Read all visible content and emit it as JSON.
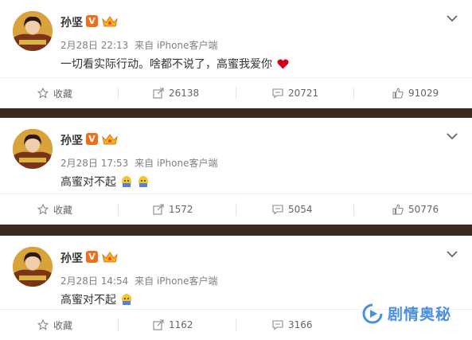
{
  "posts": [
    {
      "user": "孙坚",
      "verified_label": "V",
      "date": "2月28日 22:13",
      "source": "来自 iPhone客户端",
      "text": "一切看实际行动。啥都不说了，高蜜我爱你",
      "actions": {
        "favorite_label": "收藏",
        "repost": "26138",
        "comments": "20721",
        "likes": "91029"
      }
    },
    {
      "user": "孙坚",
      "verified_label": "V",
      "date": "2月28日 17:53",
      "source": "来自 iPhone客户端",
      "text": "高蜜对不起",
      "actions": {
        "favorite_label": "收藏",
        "repost": "1572",
        "comments": "5054",
        "likes": "50776"
      }
    },
    {
      "user": "孙坚",
      "verified_label": "V",
      "date": "2月28日 14:54",
      "source": "来自 iPhone客户端",
      "text": "高蜜对不起",
      "actions": {
        "favorite_label": "收藏",
        "repost": "1162",
        "comments": "3166",
        "likes": ""
      }
    }
  ],
  "watermark": {
    "text": "剧情奥秘"
  },
  "colors": {
    "badge": "#f06d1a",
    "heart": "#d0021b",
    "separator": "#3a2a1f",
    "watermark": "#4a8fe0"
  },
  "icons": [
    "avatar",
    "verified-badge-icon",
    "crown-badge-icon",
    "chevron-down-icon",
    "star-icon",
    "repost-icon",
    "comment-icon",
    "thumbs-up-icon",
    "heart-emoji-icon",
    "crying-emoji-icon"
  ]
}
